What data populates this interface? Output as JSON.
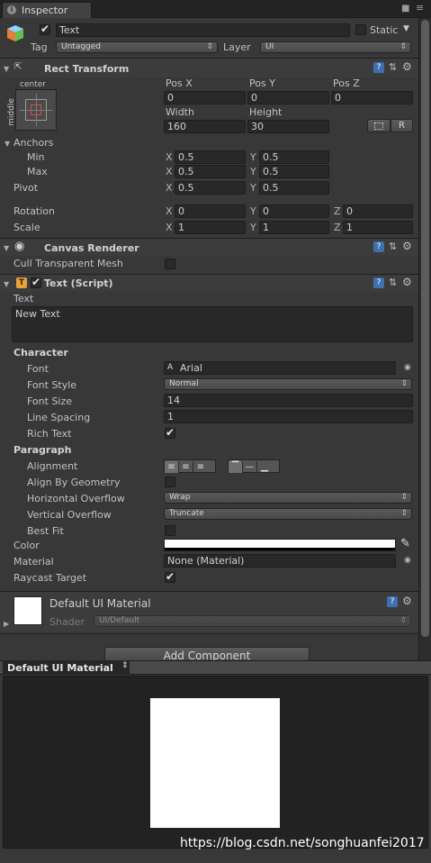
{
  "tab": {
    "title": "Inspector"
  },
  "object": {
    "name": "Text",
    "static_label": "Static",
    "tag_label": "Tag",
    "tag_value": "Untagged",
    "layer_label": "Layer",
    "layer_value": "UI"
  },
  "rect_transform": {
    "title": "Rect Transform",
    "anchor_h": "center",
    "anchor_v": "middle",
    "col_pos_x": "Pos X",
    "col_pos_y": "Pos Y",
    "col_pos_z": "Pos Z",
    "pos_x": "0",
    "pos_y": "0",
    "pos_z": "0",
    "col_width": "Width",
    "col_height": "Height",
    "width": "160",
    "height": "30",
    "r_button": "R",
    "anchors_label": "Anchors",
    "min_label": "Min",
    "max_label": "Max",
    "min_x": "0.5",
    "min_y": "0.5",
    "max_x": "0.5",
    "max_y": "0.5",
    "pivot_label": "Pivot",
    "pivot_x": "0.5",
    "pivot_y": "0.5",
    "rotation_label": "Rotation",
    "rot_x": "0",
    "rot_y": "0",
    "rot_z": "0",
    "scale_label": "Scale",
    "scale_x": "1",
    "scale_y": "1",
    "scale_z": "1",
    "axis_x": "X",
    "axis_y": "Y",
    "axis_z": "Z"
  },
  "canvas_renderer": {
    "title": "Canvas Renderer",
    "cull_label": "Cull Transparent Mesh"
  },
  "text_script": {
    "title": "Text (Script)",
    "text_label": "Text",
    "text_value": "New Text",
    "character_header": "Character",
    "font_label": "Font",
    "font_value": "Arial",
    "font_style_label": "Font Style",
    "font_style_value": "Normal",
    "font_size_label": "Font Size",
    "font_size_value": "14",
    "line_spacing_label": "Line Spacing",
    "line_spacing_value": "1",
    "rich_text_label": "Rich Text",
    "paragraph_header": "Paragraph",
    "alignment_label": "Alignment",
    "align_geometry_label": "Align By Geometry",
    "h_overflow_label": "Horizontal Overflow",
    "h_overflow_value": "Wrap",
    "v_overflow_label": "Vertical Overflow",
    "v_overflow_value": "Truncate",
    "best_fit_label": "Best Fit",
    "color_label": "Color",
    "color_value": "#ffffff",
    "material_label": "Material",
    "material_value": "None (Material)",
    "raycast_label": "Raycast Target"
  },
  "material": {
    "name": "Default UI Material",
    "shader_label": "Shader",
    "shader_value": "UI/Default"
  },
  "add_component": "Add Component",
  "preview": {
    "title": "Default UI Material",
    "watermark": "https://blog.csdn.net/songhuanfei2017"
  },
  "colors": {
    "panel": "#383838",
    "field": "#282828",
    "header": "#3c3c3c",
    "preview_bg": "#222222"
  }
}
